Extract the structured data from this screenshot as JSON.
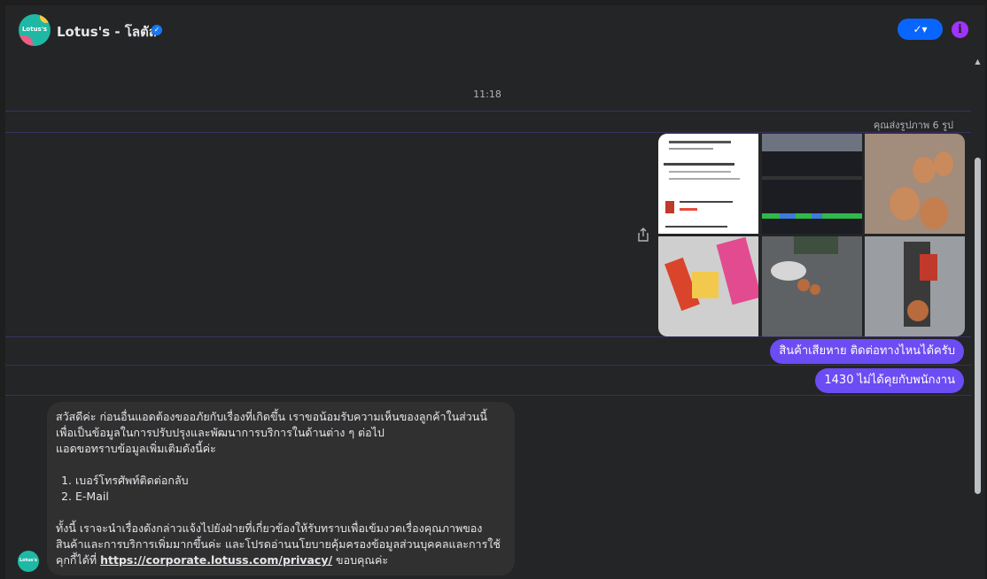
{
  "header": {
    "title": "Lotus's - โลตัส",
    "avatar_text": "Lotus's",
    "status_button": "✓▾",
    "info_icon": "i"
  },
  "conversation": {
    "timestamp": "11:18",
    "sent_photos_note": "คุณส่งรูปภาพ 6 รูป",
    "outgoing": [
      "สินค้าเสียหาย ติดต่อทางไหนได้ครับ",
      "1430 ไม่ได้คุยกับพนักงาน"
    ],
    "incoming": {
      "para1": "สวัสดีค่ะ ก่อนอื่นแอดต้องขออภัยกับเรื่องที่เกิดขึ้น เราขอน้อมรับความเห็นของลูกค้าในส่วนนี้",
      "para2": "เพื่อเป็นข้อมูลในการปรับปรุงและพัฒนาการบริการในด้านต่าง ๆ ต่อไป",
      "para3": "แอดขอทราบข้อมูลเพิ่มเติมดังนี้ค่ะ",
      "items": [
        "เบอร์โทรศัพท์ติดต่อกลับ",
        "E-Mail"
      ],
      "para4": "ทั้งนี้ เราจะนำเรื่องดังกล่าวแจ้งไปยังฝ่ายที่เกี่ยวข้องให้รับทราบเพื่อเข้มงวดเรื่องคุณภาพของ",
      "para5": "สินค้าและการบริการเพิ่มมากขึ้นค่ะ และโปรดอ่านนโยบายคุ้มครองข้อมูลส่วนบุคคลและการใช้",
      "para6_prefix": "คุกกี้ได้ที่ ",
      "link": "https://corporate.lotuss.com/privacy/",
      "para6_suffix": " ขอบคุณค่ะ"
    }
  },
  "colors": {
    "accent_blue": "#0866ff",
    "bubble_purple": "#6c4cf3",
    "info_purple": "#a033ff",
    "brand_teal": "#1fb8a4"
  }
}
